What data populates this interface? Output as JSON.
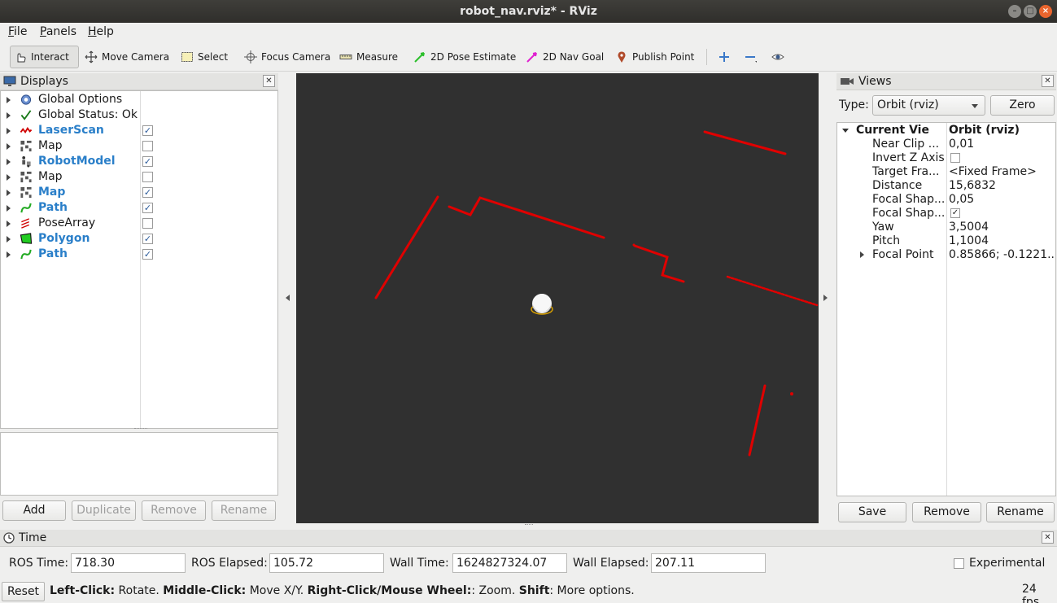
{
  "window": {
    "title": "robot_nav.rviz* - RViz"
  },
  "menu": [
    {
      "label": "File",
      "key": "F",
      "rest": "ile"
    },
    {
      "label": "Panels",
      "key": "P",
      "rest": "anels"
    },
    {
      "label": "Help",
      "key": "H",
      "rest": "elp"
    }
  ],
  "toolbar": {
    "interact": "Interact",
    "move_camera": "Move Camera",
    "select": "Select",
    "focus_camera": "Focus Camera",
    "measure": "Measure",
    "pose_estimate": "2D Pose Estimate",
    "nav_goal": "2D Nav Goal",
    "publish_point": "Publish Point"
  },
  "displays": {
    "title": "Displays",
    "items": [
      {
        "label": "Global Options",
        "enabled": null,
        "icon": "gear-icon"
      },
      {
        "label": "Global Status: Ok",
        "enabled": null,
        "icon": "checkmark-icon"
      },
      {
        "label": "LaserScan",
        "enabled": true,
        "icon": "laserscan-icon"
      },
      {
        "label": "Map",
        "enabled": false,
        "icon": "map-icon"
      },
      {
        "label": "RobotModel",
        "enabled": true,
        "icon": "robot-model-icon"
      },
      {
        "label": "Map",
        "enabled": false,
        "icon": "map-icon"
      },
      {
        "label": "Map",
        "enabled": true,
        "icon": "map-icon"
      },
      {
        "label": "Path",
        "enabled": true,
        "icon": "path-icon"
      },
      {
        "label": "PoseArray",
        "enabled": false,
        "icon": "posearray-icon"
      },
      {
        "label": "Polygon",
        "enabled": true,
        "icon": "polygon-icon"
      },
      {
        "label": "Path",
        "enabled": true,
        "icon": "path-icon"
      }
    ],
    "buttons": {
      "add": "Add",
      "duplicate": "Duplicate",
      "remove": "Remove",
      "rename": "Rename"
    }
  },
  "views": {
    "title": "Views",
    "type_label": "Type:",
    "type_value": "Orbit (rviz)",
    "zero": "Zero",
    "current_view": {
      "key": "Current View",
      "value": "Orbit (rviz)"
    },
    "props": [
      {
        "key": "Near Clip ...",
        "value": "0,01"
      },
      {
        "key": "Invert Z Axis",
        "value": "",
        "checkbox": false
      },
      {
        "key": "Target Fra...",
        "value": "<Fixed Frame>"
      },
      {
        "key": "Distance",
        "value": "15,6832"
      },
      {
        "key": "Focal Shap...",
        "value": "0,05"
      },
      {
        "key": "Focal Shap...",
        "value": "",
        "checkbox": true
      },
      {
        "key": "Yaw",
        "value": "3,5004"
      },
      {
        "key": "Pitch",
        "value": "1,1004"
      },
      {
        "key": "Focal Point",
        "value": "0.85866; -0.1221..."
      }
    ],
    "buttons": {
      "save": "Save",
      "remove": "Remove",
      "rename": "Rename"
    }
  },
  "time": {
    "title": "Time",
    "ros_time_label": "ROS Time:",
    "ros_time": "718.30",
    "ros_elapsed_label": "ROS Elapsed:",
    "ros_elapsed": "105.72",
    "wall_time_label": "Wall Time:",
    "wall_time": "1624827324.07",
    "wall_elapsed_label": "Wall Elapsed:",
    "wall_elapsed": "207.11",
    "experimental": "Experimental"
  },
  "status": {
    "reset": "Reset",
    "left_click": "Left-Click:",
    "left_click_desc": " Rotate. ",
    "middle_click": "Middle-Click:",
    "middle_click_desc": " Move X/Y. ",
    "right_click": "Right-Click/Mouse Wheel:",
    "right_click_desc": ": Zoom. ",
    "shift": "Shift",
    "shift_desc": ": More options.",
    "fps": "24 fps"
  },
  "colors": {
    "laser": "#e00000",
    "viewport_bg": "#303030",
    "accent_blue": "#2a7fc9"
  }
}
